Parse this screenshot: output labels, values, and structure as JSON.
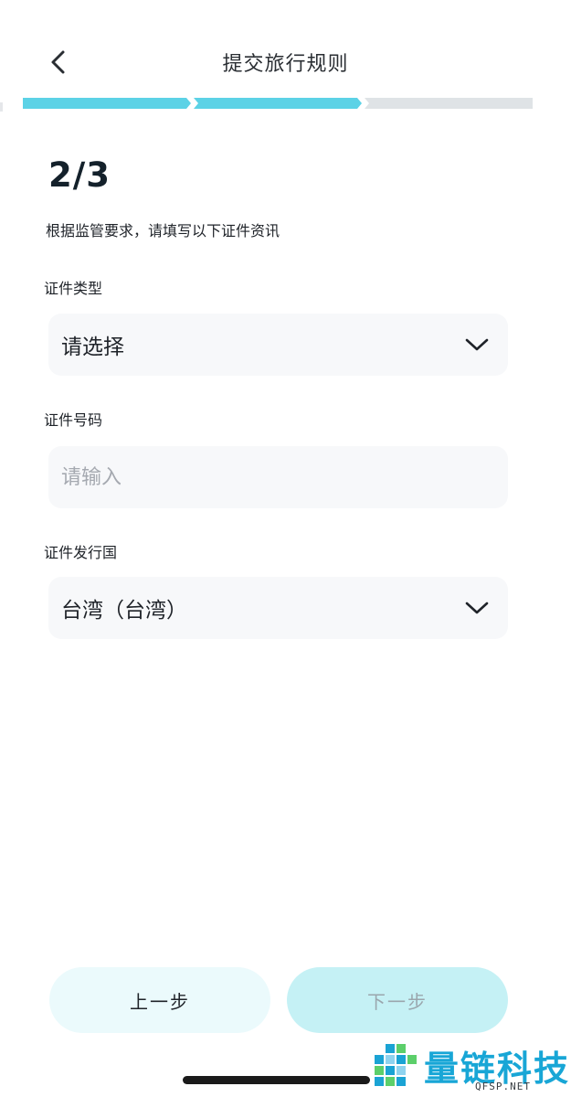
{
  "header": {
    "title": "提交旅行规则",
    "back_icon": "chevron-left-icon"
  },
  "progress": {
    "total_steps": 3,
    "completed_steps": 2,
    "active_color": "#5cd2e6",
    "inactive_color": "#dfe3e6"
  },
  "step": {
    "indicator": "2/3",
    "instruction": "根据监管要求，请填写以下证件资讯"
  },
  "form": {
    "id_type": {
      "label": "证件类型",
      "value": "请选择",
      "icon": "chevron-down-icon"
    },
    "id_number": {
      "label": "证件号码",
      "placeholder": "请输入",
      "value": ""
    },
    "issuing_country": {
      "label": "证件发行国",
      "value": "台湾（台湾）",
      "icon": "chevron-down-icon"
    }
  },
  "buttons": {
    "prev": "上一步",
    "next": "下一步"
  },
  "watermark": {
    "text": "量链科技",
    "sub": "QFSP.NET"
  }
}
